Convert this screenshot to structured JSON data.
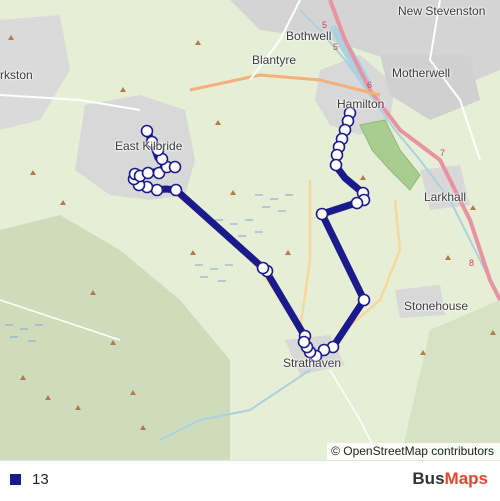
{
  "map": {
    "route_color": "#1a1a8c",
    "places": [
      {
        "id": "new-stevenston",
        "label": "New Stevenston"
      },
      {
        "id": "bothwell",
        "label": "Bothwell"
      },
      {
        "id": "airdrie-edge",
        "label": "rkston"
      },
      {
        "id": "blantyre",
        "label": "Blantyre"
      },
      {
        "id": "motherwell",
        "label": "Motherwell"
      },
      {
        "id": "hamilton",
        "label": "Hamilton"
      },
      {
        "id": "east-kilbride",
        "label": "East Kilbride"
      },
      {
        "id": "larkhall",
        "label": "Larkhall"
      },
      {
        "id": "stonehouse",
        "label": "Stonehouse"
      },
      {
        "id": "strathaven",
        "label": "Strathaven"
      }
    ],
    "road_shields": [
      "5",
      "5",
      "6",
      "7",
      "8"
    ],
    "attribution": "© OpenStreetMap contributors"
  },
  "legend": {
    "route_label": "13",
    "brand_bus": "Bus",
    "brand_maps": "Maps",
    "brand_accent": "#e8452c"
  }
}
